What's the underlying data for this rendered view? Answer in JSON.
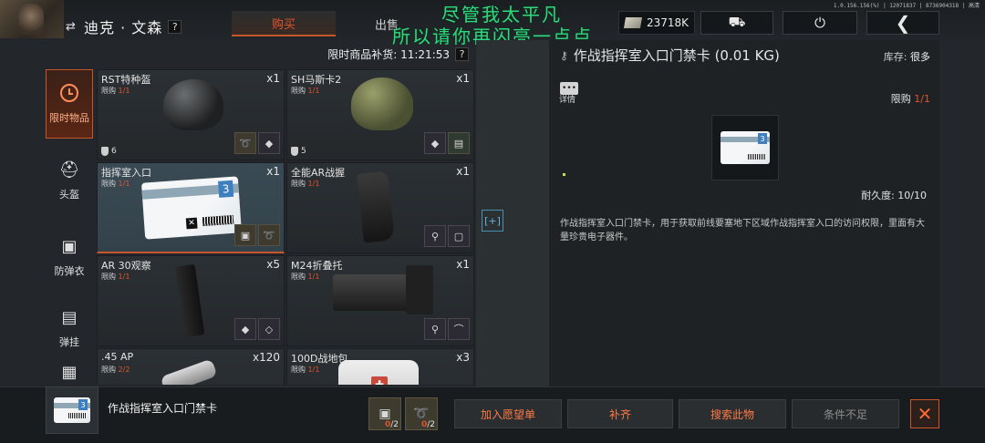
{
  "version": "1.0.156.156(%) | 12071837 | 8736904318 | 高清",
  "overlay": {
    "line1": "尽管我太平凡",
    "line2": "所以请你再闪亮一点点"
  },
  "player": {
    "name": "迪克 · 文森",
    "help": "?"
  },
  "tabs": {
    "buy": "购买",
    "sell": "出售"
  },
  "currency": {
    "amount": "23718K"
  },
  "restock": {
    "label": "限时商品补货: 11:21:53",
    "help": "?"
  },
  "categories": [
    {
      "label": "限时物品",
      "icon": "clock-icon"
    },
    {
      "label": "头盔",
      "icon": "helmet-icon"
    },
    {
      "label": "防弹衣",
      "icon": "vest-icon"
    },
    {
      "label": "弹挂",
      "icon": "rig-icon"
    }
  ],
  "items": [
    {
      "name": "RST特种盔",
      "qty": "x1",
      "limit_label": "限购",
      "limit": "1/1",
      "armor": "6"
    },
    {
      "name": "SH马斯卡2",
      "qty": "x1",
      "limit_label": "限购",
      "limit": "1/1",
      "armor": "5"
    },
    {
      "name": "指挥室入口",
      "qty": "x1",
      "limit_label": "限购",
      "limit": "1/1"
    },
    {
      "name": "全能AR战握",
      "qty": "x1",
      "limit_label": "限购",
      "limit": "1/1"
    },
    {
      "name": "AR 30观察",
      "qty": "x5",
      "limit_label": "限购",
      "limit": "1/1"
    },
    {
      "name": "M24折叠托",
      "qty": "x1",
      "limit_label": "限购",
      "limit": "1/1"
    },
    {
      "name": ".45 AP",
      "qty": "x120",
      "limit_label": "限购",
      "limit": "2/2"
    },
    {
      "name": "100D战地包",
      "qty": "x3",
      "limit_label": "限购",
      "limit": "1/1"
    }
  ],
  "detail": {
    "title": "作战指挥室入口门禁卡 (0.01 KG)",
    "stock_label": "库存:",
    "stock_value": "很多",
    "info_label": "详情",
    "limit_label": "限购",
    "limit_value": "1/1",
    "durability": "耐久度:   10/10",
    "description": "作战指挥室入口门禁卡，用于获取前线要塞地下区域作战指挥室入口的访问权限，里面有大量珍贵电子器件。"
  },
  "bottom": {
    "selected_name": "作战指挥室入口门禁卡",
    "costs": [
      {
        "have": "0",
        "need": "/2"
      },
      {
        "have": "0",
        "need": "/2"
      }
    ],
    "wishlist": "加入愿望单",
    "restock": "补齐",
    "search": "搜索此物",
    "insufficient": "条件不足"
  },
  "colors": {
    "accent": "#c8562c",
    "overlay_text": "#2fd97e"
  }
}
